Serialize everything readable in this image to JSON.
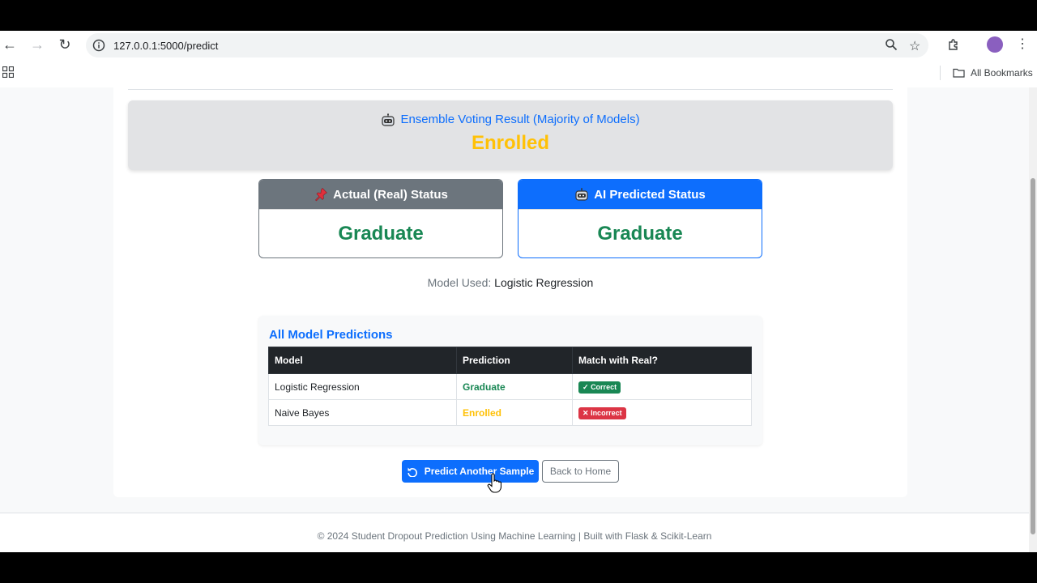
{
  "browser": {
    "url": "127.0.0.1:5000/predict",
    "bookmarks_label": "All Bookmarks"
  },
  "ensemble": {
    "title": "Ensemble Voting Result (Majority of Models)",
    "value": "Enrolled"
  },
  "actual_status": {
    "title": "Actual (Real) Status",
    "value": "Graduate"
  },
  "ai_status": {
    "title": "AI Predicted Status",
    "value": "Graduate"
  },
  "model_used": {
    "label": "Model Used:",
    "value": "Logistic Regression"
  },
  "predictions": {
    "title": "All Model Predictions",
    "headers": [
      "Model",
      "Prediction",
      "Match with Real?"
    ],
    "rows": [
      {
        "model": "Logistic Regression",
        "prediction": "Graduate",
        "match": "Correct"
      },
      {
        "model": "Naive Bayes",
        "prediction": "Enrolled",
        "match": "Incorrect"
      }
    ]
  },
  "buttons": {
    "predict_again": "Predict Another Sample",
    "back_home": "Back to Home"
  },
  "footer": {
    "text": "© 2024 Student Dropout Prediction Using Machine Learning | Built with Flask & Scikit-Learn"
  },
  "colors": {
    "primary": "#0d6efd",
    "success": "#198754",
    "warning": "#ffc107",
    "danger": "#dc3545",
    "secondary": "#6c757d"
  },
  "icons": {
    "ensemble": "robot-icon",
    "actual": "pushpin-icon",
    "ai": "robot-icon",
    "predict_again": "undo-arrow-icon"
  }
}
